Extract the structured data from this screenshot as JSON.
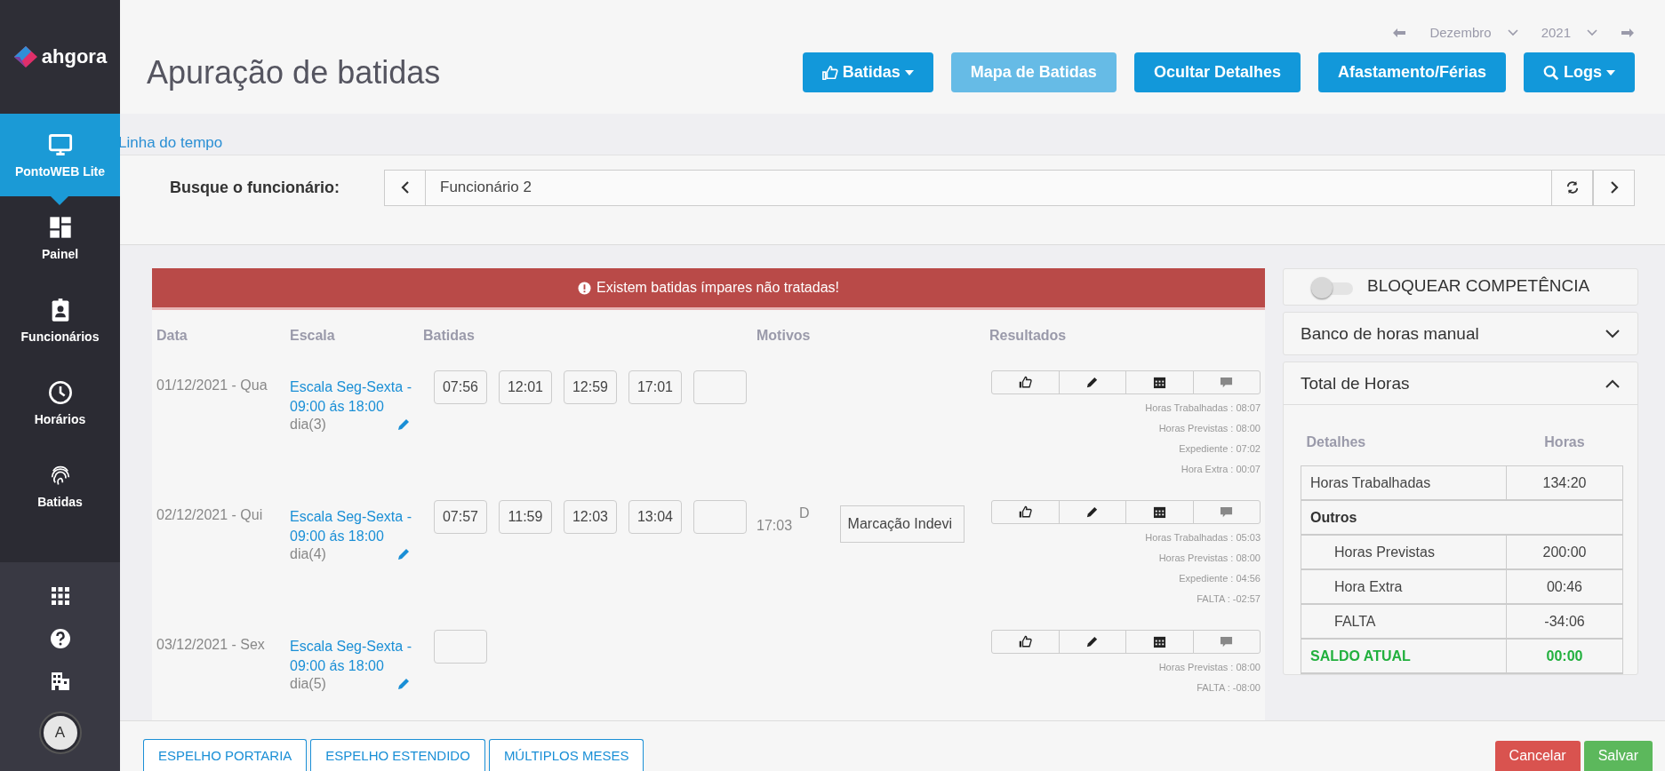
{
  "sidebar": {
    "logo": "ahgora",
    "items": [
      {
        "label": "PontoWEB Lite",
        "selected": true
      },
      {
        "label": "Painel",
        "selected": false
      },
      {
        "label": "Funcionários",
        "selected": false
      },
      {
        "label": "Horários",
        "selected": false
      },
      {
        "label": "Batidas",
        "selected": false
      }
    ],
    "avatar": "A"
  },
  "header": {
    "title": "Apuração de batidas",
    "month": "Dezembro",
    "year": "2021",
    "buttons": [
      {
        "label": "Batidas",
        "dropdown": true,
        "disabled": false
      },
      {
        "label": "Mapa de Batidas",
        "dropdown": false,
        "disabled": true
      },
      {
        "label": "Ocultar Detalhes",
        "dropdown": false,
        "disabled": false
      },
      {
        "label": "Afastamento/Férias",
        "dropdown": false,
        "disabled": false
      },
      {
        "label": "Logs",
        "dropdown": true,
        "disabled": false
      }
    ]
  },
  "breadcrumb": "Linha do tempo",
  "search": {
    "label": "Busque o funcionário:",
    "value": "Funcionário 2"
  },
  "alert": "Existem batidas ímpares não tratadas!",
  "table": {
    "columns": [
      "Data",
      "Escala",
      "Batidas",
      "Motivos",
      "Resultados"
    ],
    "rows": [
      {
        "date": "01/12/2021 - Qua",
        "scale": "Escala Seg-Sexta -",
        "hours": "09:00 ás 18:00",
        "day": "dia(3)",
        "punches": [
          "07:56",
          "12:01",
          "12:59",
          "17:01"
        ],
        "results": [
          "Horas Trabalhadas : 08:07",
          "Horas Previstas : 08:00",
          "Expediente : 07:02",
          "Hora Extra : 00:07"
        ]
      },
      {
        "date": "02/12/2021 - Qui",
        "scale": "Escala Seg-Sexta -",
        "hours": "09:00 ás 18:00",
        "day": "dia(4)",
        "punches": [
          "07:57",
          "11:59",
          "12:03",
          "13:04"
        ],
        "motive": {
          "time": "17:03",
          "flag": "D",
          "reason": "Marcação Indevi"
        },
        "results": [
          "Horas Trabalhadas : 05:03",
          "Horas Previstas : 08:00",
          "Expediente : 04:56",
          "FALTA : -02:57"
        ]
      },
      {
        "date": "03/12/2021 - Sex",
        "scale": "Escala Seg-Sexta -",
        "hours": "09:00 ás 18:00",
        "day": "dia(5)",
        "punches": [],
        "results": [
          "Horas Previstas : 08:00",
          "FALTA : -08:00"
        ]
      }
    ]
  },
  "panel": {
    "lock": {
      "label": "BLOQUEAR COMPETÊNCIA",
      "on": false
    },
    "sections": [
      {
        "title": "Banco de horas manual",
        "expanded": false
      },
      {
        "title": "Total de Horas",
        "expanded": true
      }
    ],
    "totals": {
      "columns": [
        "Detalhes",
        "Horas"
      ],
      "rows": [
        {
          "kind": "item",
          "label": "Horas Trabalhadas",
          "value": "134:20"
        },
        {
          "kind": "group",
          "label": "Outros"
        },
        {
          "kind": "sub",
          "label": "Horas Previstas",
          "value": "200:00"
        },
        {
          "kind": "sub",
          "label": "Hora Extra",
          "value": "00:46"
        },
        {
          "kind": "sub",
          "label": "FALTA",
          "value": "-34:06"
        },
        {
          "kind": "total",
          "label": "SALDO ATUAL",
          "value": "00:00"
        }
      ]
    }
  },
  "footer": {
    "reports": [
      "ESPELHO PORTARIA",
      "ESPELHO ESTENDIDO",
      "MÚLTIPLOS MESES"
    ],
    "cancel": "Cancelar",
    "save": "Salvar"
  }
}
